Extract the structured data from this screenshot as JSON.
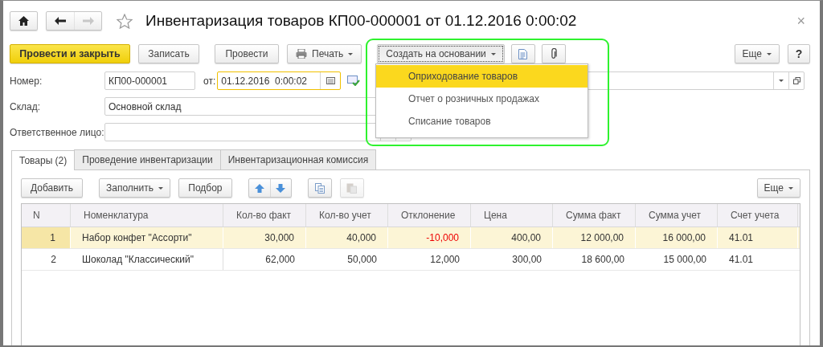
{
  "window": {
    "title": "Инвентаризация товаров КП00-000001 от 01.12.2016 0:00:02",
    "close": "×"
  },
  "toolbar": {
    "post_close": "Провести и закрыть",
    "write": "Записать",
    "post": "Провести",
    "print": "Печать",
    "create_based": {
      "label": "Создать на основании",
      "expanded": true
    },
    "more": "Еще",
    "help": "?"
  },
  "create_menu": [
    {
      "label": "Оприходование товаров",
      "selected": true
    },
    {
      "label": "Отчет о розничных продажах",
      "selected": false
    },
    {
      "label": "Списание товаров",
      "selected": false
    }
  ],
  "form": {
    "number": {
      "label": "Номер:",
      "value": "КП00-000001"
    },
    "date": {
      "label": "от:",
      "value": "01.12.2016  0:00:02",
      "focused": true
    },
    "warehouse": {
      "label": "Склад:",
      "value": "Основной склад"
    },
    "responsible": {
      "label": "Ответственное лицо:"
    }
  },
  "tabs": [
    {
      "label": "Товары (2)",
      "selected": true
    },
    {
      "label": "Проведение инвентаризации",
      "selected": false
    },
    {
      "label": "Инвентаризационная комиссия",
      "selected": false
    }
  ],
  "table_toolbar": {
    "add": "Добавить",
    "fill": "Заполнить",
    "pick": "Подбор",
    "more": "Еще"
  },
  "table": {
    "columns": [
      {
        "label": "N",
        "kind": "num"
      },
      {
        "label": "Номенклатура",
        "kind": "text"
      },
      {
        "label": "Кол-во факт",
        "kind": "num"
      },
      {
        "label": "Кол-во учет",
        "kind": "num"
      },
      {
        "label": "Отклонение",
        "kind": "num"
      },
      {
        "label": "Цена",
        "kind": "num"
      },
      {
        "label": "Сумма факт",
        "kind": "num"
      },
      {
        "label": "Сумма учет",
        "kind": "num"
      },
      {
        "label": "Счет учета",
        "kind": "text"
      }
    ],
    "rows": [
      {
        "selected": true,
        "deviation_negative": true,
        "cells": [
          "1",
          "Набор конфет \"Ассорти\"",
          "30,000",
          "40,000",
          "-10,000",
          "400,00",
          "12 000,00",
          "16 000,00",
          "41.01"
        ]
      },
      {
        "selected": false,
        "deviation_negative": false,
        "cells": [
          "2",
          "Шоколад \"Классический\"",
          "62,000",
          "50,000",
          "12,000",
          "300,00",
          "18 600,00",
          "15 000,00",
          "41.01"
        ]
      }
    ]
  }
}
